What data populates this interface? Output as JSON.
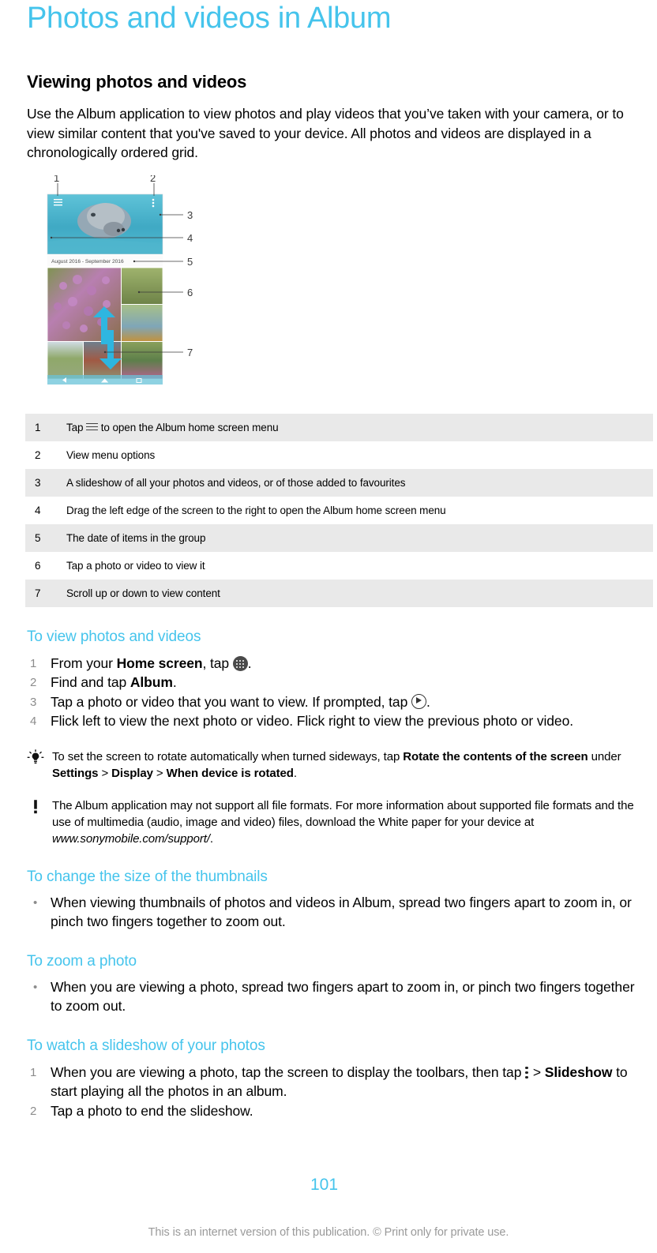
{
  "document": {
    "title": "Photos and videos in Album",
    "accent_color": "#45c4ec",
    "page_number": "101",
    "footer": "This is an internet version of this publication. © Print only for private use."
  },
  "section": {
    "heading": "Viewing photos and videos",
    "intro": "Use the Album application to view photos and play videos that you’ve taken with your camera, or to view similar content that you've saved to your device. All photos and videos are displayed in a chronologically ordered grid."
  },
  "figure": {
    "name": "album-home-screen-diagram",
    "callout_numbers": [
      "1",
      "2",
      "3",
      "4",
      "5",
      "6",
      "7"
    ],
    "date_group_label": "August 2016 - September 2016"
  },
  "legend": {
    "rows": [
      {
        "num": "1",
        "pre": "Tap ",
        "icon": "hamburger-icon",
        "post": " to open the Album home screen menu"
      },
      {
        "num": "2",
        "text": "View menu options"
      },
      {
        "num": "3",
        "text": "A slideshow of all your photos and videos, or of those added to favourites"
      },
      {
        "num": "4",
        "text": "Drag the left edge of the screen to the right to open the Album home screen menu"
      },
      {
        "num": "5",
        "text": "The date of items in the group"
      },
      {
        "num": "6",
        "text": "Tap a photo or video to view it"
      },
      {
        "num": "7",
        "text": "Scroll up or down to view content"
      }
    ]
  },
  "to_view": {
    "heading": "To view photos and videos",
    "step1_a": "From your ",
    "step1_b": "Home screen",
    "step1_c": ", tap ",
    "step1_d": ".",
    "step2_a": "Find and tap ",
    "step2_b": "Album",
    "step2_c": ".",
    "step3_a": "Tap a photo or video that you want to view. If prompted, tap ",
    "step3_b": ".",
    "step4": "Flick left to view the next photo or video. Flick right to view the previous photo or video."
  },
  "tip": {
    "icon": "lightbulb-icon",
    "a": "To set the screen to rotate automatically when turned sideways, tap ",
    "b": "Rotate the contents of the screen",
    "c": " under ",
    "d": "Settings",
    "e": " > ",
    "f": "Display",
    "g": " > ",
    "h": "When device is rotated",
    "i": "."
  },
  "note": {
    "icon": "exclamation-icon",
    "a": "The Album application may not support all file formats. For more information about supported file formats and the use of multimedia (audio, image and video) files, download the White paper for your device at ",
    "b": "www.sonymobile.com/support/",
    "c": "."
  },
  "thumbnails": {
    "heading": "To change the size of the thumbnails",
    "bullet": "When viewing thumbnails of photos and videos in Album, spread two fingers apart to zoom in, or pinch two fingers together to zoom out."
  },
  "zoom_photo": {
    "heading": "To zoom a photo",
    "bullet": "When you are viewing a photo, spread two fingers apart to zoom in, or pinch two fingers together to zoom out."
  },
  "slideshow": {
    "heading": "To watch a slideshow of your photos",
    "step1_a": "When you are viewing a photo, tap the screen to display the toolbars, then tap ",
    "step1_b": " > ",
    "step1_c": "Slideshow",
    "step1_d": " to start playing all the photos in an album.",
    "step2": "Tap a photo to end the slideshow."
  }
}
